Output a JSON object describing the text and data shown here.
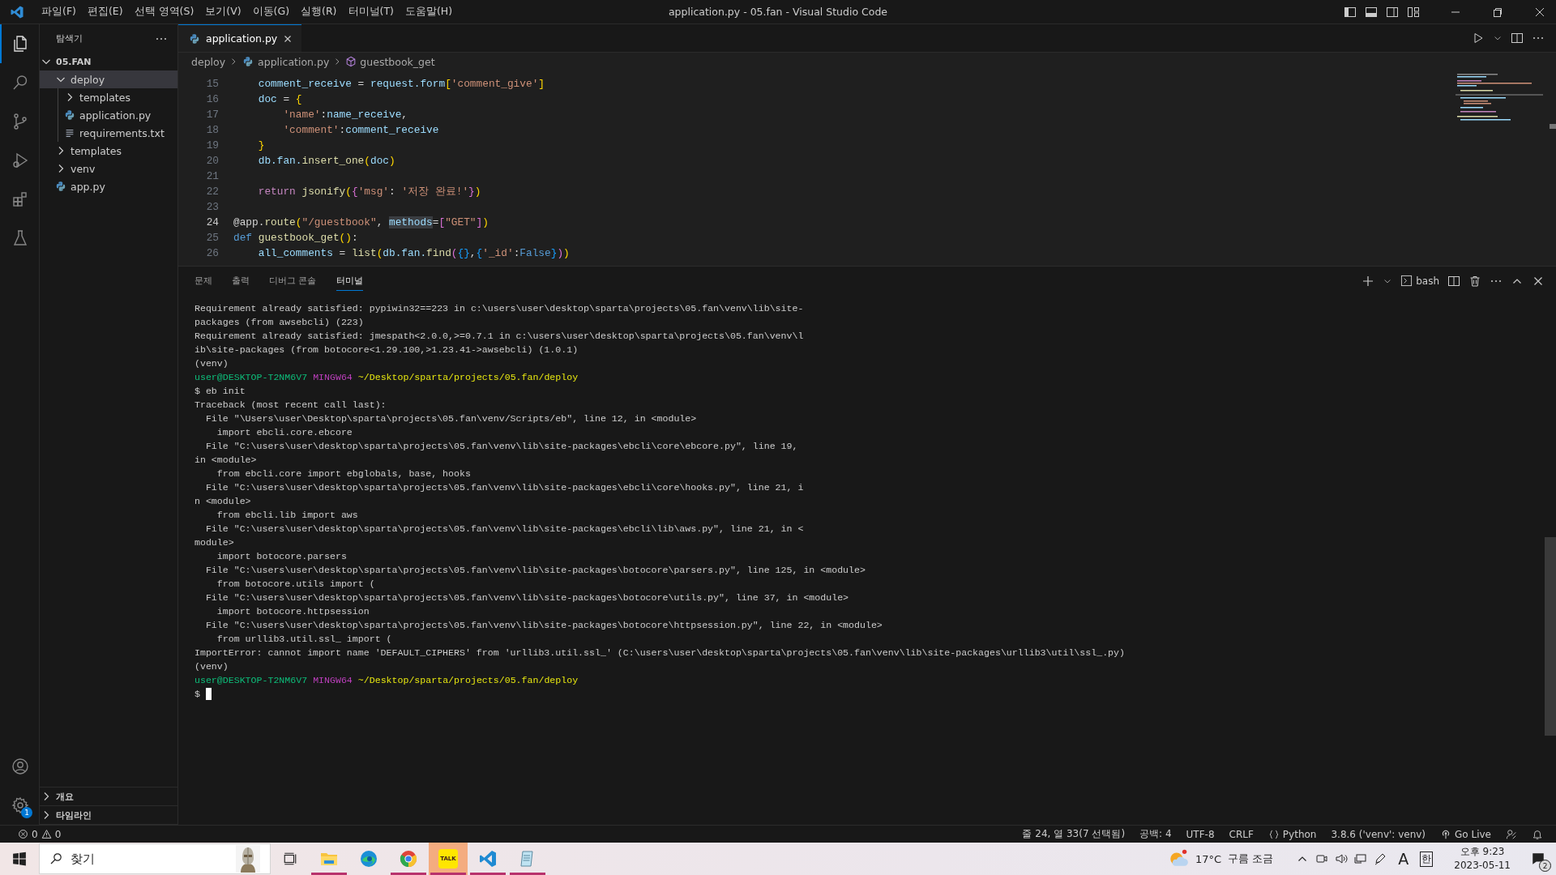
{
  "title_bar": {
    "menus": [
      "파일(F)",
      "편집(E)",
      "선택 영역(S)",
      "보기(V)",
      "이동(G)",
      "실행(R)",
      "터미널(T)",
      "도움말(H)"
    ],
    "title": "application.py - 05.fan - Visual Studio Code"
  },
  "activity_bar": {
    "items": [
      {
        "kind": "explorer",
        "selected": true
      },
      {
        "kind": "search",
        "selected": false
      },
      {
        "kind": "source-control",
        "selected": false
      },
      {
        "kind": "run",
        "selected": false
      },
      {
        "kind": "extensions",
        "selected": false
      },
      {
        "kind": "testing",
        "selected": false
      }
    ],
    "settings_badge": "1"
  },
  "sidebar": {
    "title": "탐색기",
    "root": {
      "label": "05.FAN",
      "expanded": true
    },
    "tree": [
      {
        "label": "deploy",
        "kind": "folder",
        "expanded": true,
        "selected": true,
        "children": [
          {
            "label": "templates",
            "kind": "folder",
            "expanded": false,
            "selected": false
          },
          {
            "label": "application.py",
            "kind": "python",
            "selected": false
          },
          {
            "label": "requirements.txt",
            "kind": "text",
            "selected": false
          }
        ]
      },
      {
        "label": "templates",
        "kind": "folder",
        "expanded": false,
        "selected": false
      },
      {
        "label": "venv",
        "kind": "folder",
        "expanded": false,
        "selected": false
      },
      {
        "label": "app.py",
        "kind": "python",
        "selected": false
      }
    ],
    "sections": [
      {
        "label": "개요",
        "expanded": false
      },
      {
        "label": "타임라인",
        "expanded": false
      }
    ]
  },
  "editor": {
    "tabs": [
      {
        "label": "application.py",
        "selected": true
      }
    ],
    "breadcrumb": [
      {
        "label": "deploy",
        "kind": "folder"
      },
      {
        "label": "application.py",
        "kind": "python"
      },
      {
        "label": "guestbook_get",
        "kind": "method"
      }
    ],
    "lines": [
      {
        "number": "15",
        "current": false,
        "tokens": [
          {
            "kind": "var",
            "text": "    comment_receive"
          },
          {
            "kind": "plain",
            "text": " = "
          },
          {
            "kind": "var",
            "text": "request.form"
          },
          {
            "kind": "bracket-1",
            "text": "["
          },
          {
            "kind": "str",
            "text": "'comment_give'"
          },
          {
            "kind": "bracket-1",
            "text": "]"
          }
        ]
      },
      {
        "number": "16",
        "current": false,
        "tokens": [
          {
            "kind": "var",
            "text": "    doc"
          },
          {
            "kind": "plain",
            "text": " = "
          },
          {
            "kind": "bracket-1",
            "text": "{"
          }
        ]
      },
      {
        "number": "17",
        "current": false,
        "tokens": [
          {
            "kind": "str",
            "text": "        'name'"
          },
          {
            "kind": "plain",
            "text": ":"
          },
          {
            "kind": "var",
            "text": "name_receive"
          },
          {
            "kind": "plain",
            "text": ","
          }
        ]
      },
      {
        "number": "18",
        "current": false,
        "tokens": [
          {
            "kind": "str",
            "text": "        'comment'"
          },
          {
            "kind": "plain",
            "text": ":"
          },
          {
            "kind": "var",
            "text": "comment_receive"
          }
        ]
      },
      {
        "number": "19",
        "current": false,
        "tokens": [
          {
            "kind": "bracket-1",
            "text": "    }"
          }
        ]
      },
      {
        "number": "20",
        "current": false,
        "tokens": [
          {
            "kind": "var",
            "text": "    db.fan."
          },
          {
            "kind": "fn",
            "text": "insert_one"
          },
          {
            "kind": "bracket-1",
            "text": "("
          },
          {
            "kind": "var",
            "text": "doc"
          },
          {
            "kind": "bracket-1",
            "text": ")"
          }
        ]
      },
      {
        "number": "21",
        "current": false
      },
      {
        "number": "22",
        "current": false,
        "tokens": [
          {
            "kind": "kw",
            "text": "    return"
          },
          {
            "kind": "fn",
            "text": " jsonify"
          },
          {
            "kind": "bracket-1",
            "text": "("
          },
          {
            "kind": "bracket-2",
            "text": "{"
          },
          {
            "kind": "str",
            "text": "'msg'"
          },
          {
            "kind": "plain",
            "text": ": "
          },
          {
            "kind": "str",
            "text": "'저장 완료!'"
          },
          {
            "kind": "bracket-2",
            "text": "}"
          },
          {
            "kind": "bracket-1",
            "text": ")"
          }
        ]
      },
      {
        "number": "23",
        "current": false
      },
      {
        "number": "24",
        "current": true,
        "tokens": [
          {
            "kind": "plain",
            "text": "@app."
          },
          {
            "kind": "fn",
            "text": "route"
          },
          {
            "kind": "bracket-1",
            "text": "("
          },
          {
            "kind": "str",
            "text": "\"/guestbook\""
          },
          {
            "kind": "plain",
            "text": ", "
          },
          {
            "kind": "selection",
            "text": "methods"
          },
          {
            "kind": "plain",
            "text": "="
          },
          {
            "kind": "bracket-2",
            "text": "["
          },
          {
            "kind": "str",
            "text": "\"GET\""
          },
          {
            "kind": "bracket-2",
            "text": "]"
          },
          {
            "kind": "bracket-1",
            "text": ")"
          }
        ]
      },
      {
        "number": "25",
        "current": false,
        "tokens": [
          {
            "kind": "def",
            "text": "def"
          },
          {
            "kind": "fn",
            "text": " guestbook_get"
          },
          {
            "kind": "bracket-1",
            "text": "()"
          },
          {
            "kind": "plain",
            "text": ":"
          }
        ]
      },
      {
        "number": "26",
        "current": false,
        "tokens": [
          {
            "kind": "var",
            "text": "    all_comments"
          },
          {
            "kind": "plain",
            "text": " = "
          },
          {
            "kind": "fn",
            "text": "list"
          },
          {
            "kind": "bracket-1",
            "text": "("
          },
          {
            "kind": "var",
            "text": "db.fan."
          },
          {
            "kind": "fn",
            "text": "find"
          },
          {
            "kind": "bracket-2",
            "text": "("
          },
          {
            "kind": "bracket-3",
            "text": "{}"
          },
          {
            "kind": "plain",
            "text": ","
          },
          {
            "kind": "bracket-3",
            "text": "{"
          },
          {
            "kind": "str",
            "text": "'_id'"
          },
          {
            "kind": "plain",
            "text": ":"
          },
          {
            "kind": "def",
            "text": "False"
          },
          {
            "kind": "bracket-3",
            "text": "}"
          },
          {
            "kind": "bracket-2",
            "text": ")"
          },
          {
            "kind": "bracket-1",
            "text": ")"
          }
        ]
      }
    ]
  },
  "panel": {
    "tabs": [
      {
        "label": "문제",
        "selected": false
      },
      {
        "label": "출력",
        "selected": false
      },
      {
        "label": "디버그 콘솔",
        "selected": false
      },
      {
        "label": "터미널",
        "selected": true
      }
    ],
    "shell": "bash",
    "terminal": [
      {
        "kind": "output",
        "text": "Requirement already satisfied: pypiwin32==223 in c:\\users\\user\\desktop\\sparta\\projects\\05.fan\\venv\\lib\\site-"
      },
      {
        "kind": "output",
        "text": "packages (from awsebcli) (223)"
      },
      {
        "kind": "output",
        "text": "Requirement already satisfied: jmespath<2.0.0,>=0.7.1 in c:\\users\\user\\desktop\\sparta\\projects\\05.fan\\venv\\l"
      },
      {
        "kind": "output",
        "text": "ib\\site-packages (from botocore<1.29.100,>1.23.41->awsebcli) (1.0.1)"
      },
      {
        "kind": "output",
        "text": "(venv)"
      },
      {
        "kind": "prompt",
        "user": "user@DESKTOP-T2NM6V7",
        "system": "MINGW64",
        "path": "~/Desktop/sparta/projects/05.fan/deploy"
      },
      {
        "kind": "output",
        "text": "$ eb init"
      },
      {
        "kind": "output",
        "text": "Traceback (most recent call last):"
      },
      {
        "kind": "output",
        "text": "  File \"\\Users\\user\\Desktop\\sparta\\projects\\05.fan\\venv/Scripts/eb\", line 12, in <module>"
      },
      {
        "kind": "output",
        "text": "    import ebcli.core.ebcore"
      },
      {
        "kind": "output",
        "text": "  File \"C:\\users\\user\\desktop\\sparta\\projects\\05.fan\\venv\\lib\\site-packages\\ebcli\\core\\ebcore.py\", line 19,"
      },
      {
        "kind": "output",
        "text": "in <module>"
      },
      {
        "kind": "output",
        "text": "    from ebcli.core import ebglobals, base, hooks"
      },
      {
        "kind": "output",
        "text": "  File \"C:\\users\\user\\desktop\\sparta\\projects\\05.fan\\venv\\lib\\site-packages\\ebcli\\core\\hooks.py\", line 21, i"
      },
      {
        "kind": "output",
        "text": "n <module>"
      },
      {
        "kind": "output",
        "text": "    from ebcli.lib import aws"
      },
      {
        "kind": "output",
        "text": "  File \"C:\\users\\user\\desktop\\sparta\\projects\\05.fan\\venv\\lib\\site-packages\\ebcli\\lib\\aws.py\", line 21, in <"
      },
      {
        "kind": "output",
        "text": "module>"
      },
      {
        "kind": "output",
        "text": "    import botocore.parsers"
      },
      {
        "kind": "output",
        "text": "  File \"C:\\users\\user\\desktop\\sparta\\projects\\05.fan\\venv\\lib\\site-packages\\botocore\\parsers.py\", line 125, in <module>"
      },
      {
        "kind": "output",
        "text": "    from botocore.utils import ("
      },
      {
        "kind": "output",
        "text": "  File \"C:\\users\\user\\desktop\\sparta\\projects\\05.fan\\venv\\lib\\site-packages\\botocore\\utils.py\", line 37, in <module>"
      },
      {
        "kind": "output",
        "text": "    import botocore.httpsession"
      },
      {
        "kind": "output",
        "text": "  File \"C:\\users\\user\\desktop\\sparta\\projects\\05.fan\\venv\\lib\\site-packages\\botocore\\httpsession.py\", line 22, in <module>"
      },
      {
        "kind": "output",
        "text": "    from urllib3.util.ssl_ import ("
      },
      {
        "kind": "output",
        "text": "ImportError: cannot import name 'DEFAULT_CIPHERS' from 'urllib3.util.ssl_' (C:\\users\\user\\desktop\\sparta\\projects\\05.fan\\venv\\lib\\site-packages\\urllib3\\util\\ssl_.py)"
      },
      {
        "kind": "output",
        "text": "(venv)"
      },
      {
        "kind": "prompt",
        "user": "user@DESKTOP-T2NM6V7",
        "system": "MINGW64",
        "path": "~/Desktop/sparta/projects/05.fan/deploy"
      },
      {
        "kind": "input",
        "text": "$"
      }
    ]
  },
  "status_bar": {
    "errors": "0",
    "warnings": "0",
    "items": [
      {
        "kind": "text",
        "text": "줄 24, 열 33(7 선택됨)"
      },
      {
        "kind": "text",
        "text": "공백: 4"
      },
      {
        "kind": "text",
        "text": "UTF-8"
      },
      {
        "kind": "text",
        "text": "CRLF"
      },
      {
        "kind": "language",
        "text": "Python"
      },
      {
        "kind": "text",
        "text": "3.8.6 ('venv': venv)"
      },
      {
        "kind": "live",
        "text": "Go Live"
      }
    ]
  },
  "taskbar": {
    "search_placeholder": "찾기",
    "apps": [
      {
        "kind": "explorer",
        "running": true,
        "active": false
      },
      {
        "kind": "edge",
        "running": false,
        "active": false
      },
      {
        "kind": "chrome",
        "running": true,
        "active": false
      },
      {
        "kind": "kakao",
        "label": "TALK",
        "running": true,
        "active": true
      },
      {
        "kind": "vscode",
        "running": true,
        "active": false
      },
      {
        "kind": "notepad",
        "running": true,
        "active": false
      }
    ],
    "weather": {
      "temperature": "17°C",
      "condition": "구름 조금"
    },
    "input_mode": "A",
    "ime": "한",
    "time": "오후 9:23",
    "date": "2023-05-11",
    "notifications": "2"
  }
}
